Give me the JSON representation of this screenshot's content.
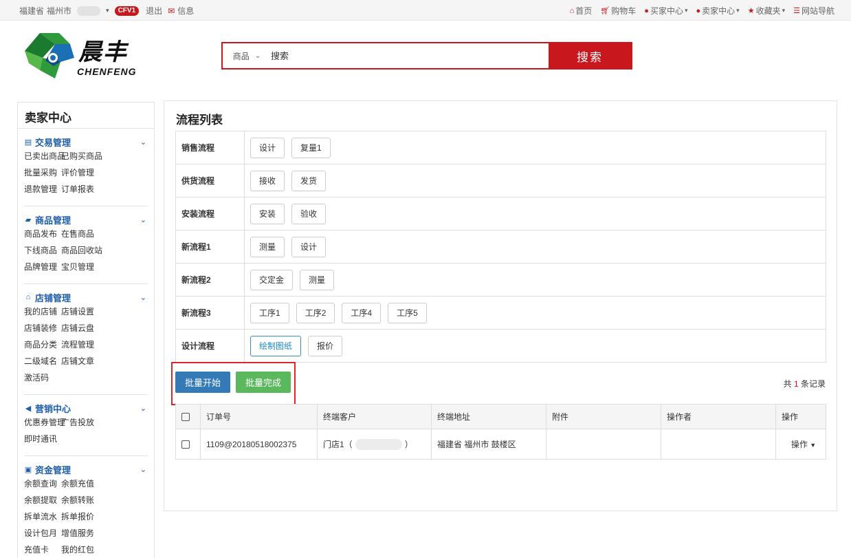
{
  "topbar": {
    "province": "福建省",
    "city": "福州市",
    "level_badge": "CFV1",
    "logout": "退出",
    "messages": "信息",
    "nav": [
      {
        "label": "首页",
        "icon": "home-icon"
      },
      {
        "label": "购物车",
        "icon": "cart-icon"
      },
      {
        "label": "买家中心",
        "icon": "user-icon"
      },
      {
        "label": "卖家中心",
        "icon": "user-icon"
      },
      {
        "label": "收藏夹",
        "icon": "star-icon"
      },
      {
        "label": "网站导航",
        "icon": "list-icon"
      }
    ]
  },
  "logo": {
    "cn": "晨丰",
    "en": "CHENFENG"
  },
  "search": {
    "category": "商品",
    "placeholder": "搜索",
    "button": "搜索"
  },
  "sidebar": {
    "title": "卖家中心",
    "groups": [
      {
        "title": "交易管理",
        "icon": "card-icon",
        "items": [
          "已卖出商品",
          "已购买商品",
          "批量采购",
          "评价管理",
          "退款管理",
          "订单报表"
        ]
      },
      {
        "title": "商品管理",
        "icon": "truck-icon",
        "items": [
          "商品发布",
          "在售商品",
          "下线商品",
          "商品回收站",
          "品牌管理",
          "宝贝管理"
        ]
      },
      {
        "title": "店铺管理",
        "icon": "home-icon",
        "items": [
          "我的店铺",
          "店铺设置",
          "店铺装修",
          "店铺云盘",
          "商品分类",
          "流程管理",
          "二级域名",
          "店铺文章",
          "激活码"
        ]
      },
      {
        "title": "营销中心",
        "icon": "volume-icon",
        "items": [
          "优惠券管理",
          "广告投放",
          "即时通讯"
        ]
      },
      {
        "title": "资金管理",
        "icon": "money-icon",
        "items": [
          "余额查询",
          "余额充值",
          "余额提取",
          "余额转账",
          "拆单流水",
          "拆单报价",
          "设计包月",
          "增值服务",
          "充值卡",
          "我的红包"
        ]
      }
    ]
  },
  "main": {
    "title": "流程列表",
    "flows": [
      {
        "name": "销售流程",
        "steps": [
          "设计",
          "复量1"
        ]
      },
      {
        "name": "供货流程",
        "steps": [
          "接收",
          "发货"
        ]
      },
      {
        "name": "安装流程",
        "steps": [
          "安装",
          "验收"
        ]
      },
      {
        "name": "新流程1",
        "steps": [
          "测量",
          "设计"
        ]
      },
      {
        "name": "新流程2",
        "steps": [
          "交定金",
          "测量"
        ]
      },
      {
        "name": "新流程3",
        "steps": [
          "工序1",
          "工序2",
          "工序4",
          "工序5"
        ]
      },
      {
        "name": "设计流程",
        "steps": [
          "绘制图纸",
          "报价"
        ]
      }
    ],
    "batch_start": "批量开始",
    "batch_done": "批量完成",
    "total_prefix": "共",
    "total_count": "1",
    "total_suffix": "条记录",
    "table": {
      "headers": [
        "订单号",
        "终端客户",
        "终端地址",
        "附件",
        "操作者",
        "操作"
      ],
      "rows": [
        {
          "order_no": "1109@20180518002375",
          "customer_prefix": "门店1（",
          "customer_suffix": "）",
          "address": "福建省 福州市 鼓楼区",
          "attachment": "",
          "operator": "",
          "action": "操作"
        }
      ]
    }
  },
  "colors": {
    "brand_red": "#c9171e",
    "primary_blue": "#337ab7",
    "success_green": "#5cb85c",
    "link_blue": "#1f5ea8"
  }
}
